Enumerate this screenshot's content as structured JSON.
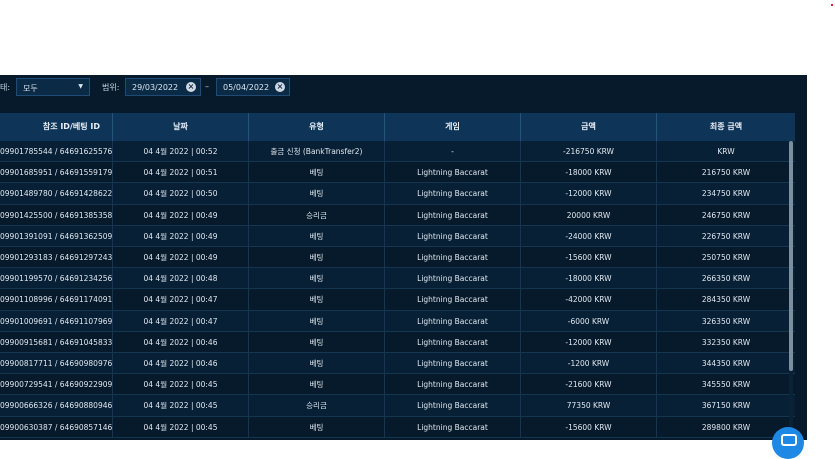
{
  "filters": {
    "status_label": "상태:",
    "status_visible": "태:",
    "status_value": "모두",
    "range_label": "범위:",
    "date_from": "29/03/2022",
    "date_to": "05/04/2022",
    "dash": "–"
  },
  "table": {
    "headers": [
      "참조 ID/베팅 ID",
      "날짜",
      "유형",
      "게임",
      "금액",
      "최종 금액"
    ],
    "rows": [
      [
        "09901785544 / 64691625576",
        "04 4월 2022 | 00:52",
        "출금 신청 (BankTransfer2)",
        "-",
        "-216750 KRW",
        "KRW"
      ],
      [
        "09901685951 / 64691559179",
        "04 4월 2022 | 00:51",
        "베팅",
        "Lightning Baccarat",
        "-18000 KRW",
        "216750 KRW"
      ],
      [
        "09901489780 / 64691428622",
        "04 4월 2022 | 00:50",
        "베팅",
        "Lightning Baccarat",
        "-12000 KRW",
        "234750 KRW"
      ],
      [
        "09901425500 / 64691385358",
        "04 4월 2022 | 00:49",
        "승리금",
        "Lightning Baccarat",
        "20000 KRW",
        "246750 KRW"
      ],
      [
        "09901391091 / 64691362509",
        "04 4월 2022 | 00:49",
        "베팅",
        "Lightning Baccarat",
        "-24000 KRW",
        "226750 KRW"
      ],
      [
        "09901293183 / 64691297243",
        "04 4월 2022 | 00:49",
        "베팅",
        "Lightning Baccarat",
        "-15600 KRW",
        "250750 KRW"
      ],
      [
        "09901199570 / 64691234256",
        "04 4월 2022 | 00:48",
        "베팅",
        "Lightning Baccarat",
        "-18000 KRW",
        "266350 KRW"
      ],
      [
        "09901108996 / 64691174091",
        "04 4월 2022 | 00:47",
        "베팅",
        "Lightning Baccarat",
        "-42000 KRW",
        "284350 KRW"
      ],
      [
        "09901009691 / 64691107969",
        "04 4월 2022 | 00:47",
        "베팅",
        "Lightning Baccarat",
        "-6000 KRW",
        "326350 KRW"
      ],
      [
        "09900915681 / 64691045833",
        "04 4월 2022 | 00:46",
        "베팅",
        "Lightning Baccarat",
        "-12000 KRW",
        "332350 KRW"
      ],
      [
        "09900817711 / 64690980976",
        "04 4월 2022 | 00:46",
        "베팅",
        "Lightning Baccarat",
        "-1200 KRW",
        "344350 KRW"
      ],
      [
        "09900729541 / 64690922909",
        "04 4월 2022 | 00:45",
        "베팅",
        "Lightning Baccarat",
        "-21600 KRW",
        "345550 KRW"
      ],
      [
        "09900666326 / 64690880946",
        "04 4월 2022 | 00:45",
        "승리금",
        "Lightning Baccarat",
        "77350 KRW",
        "367150 KRW"
      ],
      [
        "09900630387 / 64690857146",
        "04 4월 2022 | 00:45",
        "베팅",
        "Lightning Baccarat",
        "-15600 KRW",
        "289800 KRW"
      ]
    ]
  },
  "colors": {
    "panel": "#071a2b",
    "header": "#0e3458",
    "accent": "#1e88e5"
  },
  "icons": {
    "caret": "chevron-down-icon",
    "clear": "clear-x-icon",
    "chat": "chat-icon"
  }
}
